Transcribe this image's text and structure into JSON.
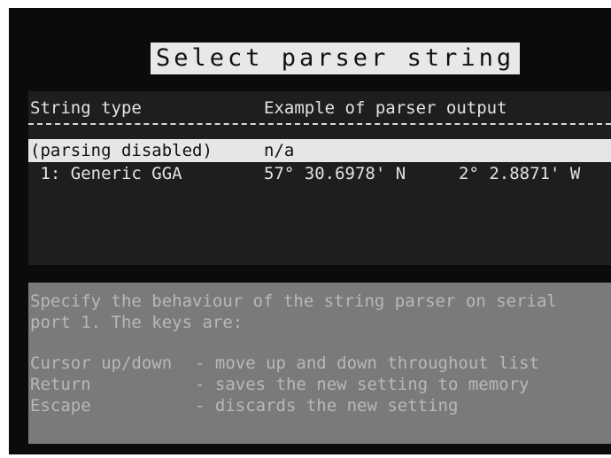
{
  "title": "Select parser string",
  "list": {
    "headers": {
      "type": "String type",
      "example": "Example of parser output"
    },
    "rows": [
      {
        "type": "(parsing disabled)",
        "lat": "n/a",
        "lon": ""
      },
      {
        "type": " 1: Generic GGA",
        "lat": "57° 30.6978' N",
        "lon": "2° 2.8871' W"
      }
    ],
    "selected_index": 0
  },
  "help": {
    "description_line1": "Specify the behaviour of the string parser on serial",
    "description_line2": "port 1. The keys are:",
    "keys": [
      {
        "key": "Cursor up/down",
        "action": "- move up and down throughout list"
      },
      {
        "key": "Return",
        "action": "- saves the new setting to memory"
      },
      {
        "key": "Escape",
        "action": "- discards the new setting"
      }
    ]
  },
  "colors": {
    "screen_bg": "#0b0b0b",
    "highlight_bg": "#e6e6e6",
    "help_bg": "#7a7a7a",
    "text": "#e2e2e2"
  }
}
